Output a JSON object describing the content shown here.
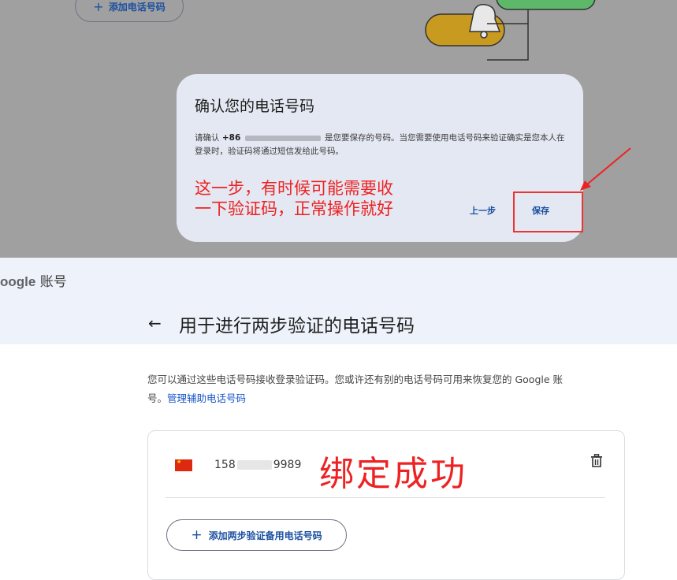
{
  "top_panel": {
    "add_phone_button": "添加电话号码",
    "add_icon": "plus-icon",
    "illustration": "bell-illustration"
  },
  "dialog": {
    "title": "确认您的电话号码",
    "body_prefix": "请确认",
    "country_code": "+86",
    "body_rest": "是您要保存的号码。当您需要使用电话号码来验证确实是您本人在登录时，验证码将通过短信发给此号码。",
    "back_button": "上一步",
    "save_button": "保存"
  },
  "annotations": {
    "note": "这一步，有时候可能需要收\n一下验证码，正常操作就好",
    "success": "绑定成功",
    "color": "#ee2222"
  },
  "header": {
    "brand": "oogle",
    "brand_suffix": "账号"
  },
  "page": {
    "back_icon": "arrow-left-icon",
    "title": "用于进行两步验证的电话号码",
    "intro": "您可以通过这些电话号码接收登录验证码。您或许还有别的电话号码可用来恢复您的 Google 账号。",
    "manage_link": "管理辅助电话号码"
  },
  "phone_card": {
    "flag_icon": "china-flag-icon",
    "phone_prefix": "158",
    "phone_suffix": "9989",
    "delete_icon": "trash-icon",
    "add_backup_button": "添加两步验证备用电话号码"
  },
  "colors": {
    "accent": "#1a4fa0",
    "link": "#1a56c6",
    "annotation": "#ee2222"
  }
}
